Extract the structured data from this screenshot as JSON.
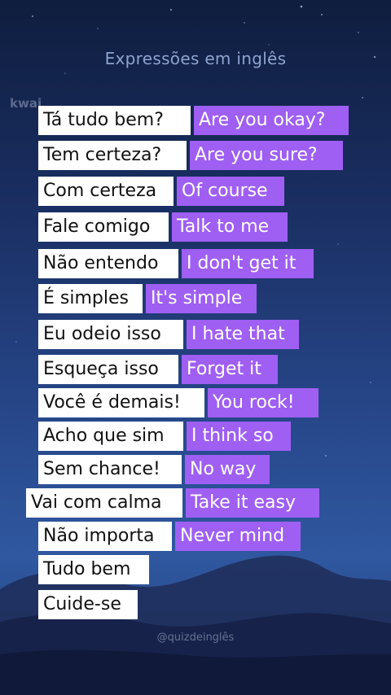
{
  "title": "Expressões em inglês",
  "watermark": {
    "logo_text": "kwai",
    "handle": "@quizdeinglês"
  },
  "colors": {
    "english_box": "#9f5ff3",
    "portuguese_box": "#ffffff",
    "sky": "#1a2f63"
  },
  "phrases": [
    {
      "pt": "Tá tudo bem?",
      "en": "Are you okay?"
    },
    {
      "pt": "Tem certeza?",
      "en": "Are you sure?"
    },
    {
      "pt": "Com certeza",
      "en": "Of course"
    },
    {
      "pt": "Fale comigo",
      "en": "Talk to me"
    },
    {
      "pt": "Não entendo",
      "en": "I don't get it"
    },
    {
      "pt": "É simples",
      "en": "It's simple"
    },
    {
      "pt": "Eu odeio isso",
      "en": "I hate that"
    },
    {
      "pt": "Esqueça isso",
      "en": "Forget it"
    },
    {
      "pt": "Você é demais!",
      "en": "You rock!"
    },
    {
      "pt": "Acho que sim",
      "en": "I think so"
    },
    {
      "pt": "Sem chance!",
      "en": "No way"
    },
    {
      "pt": "Vai com calma",
      "en": "Take it easy"
    },
    {
      "pt": "Não importa",
      "en": "Never mind"
    },
    {
      "pt": "Tudo bem",
      "en": ""
    },
    {
      "pt": "Cuide-se",
      "en": ""
    }
  ]
}
